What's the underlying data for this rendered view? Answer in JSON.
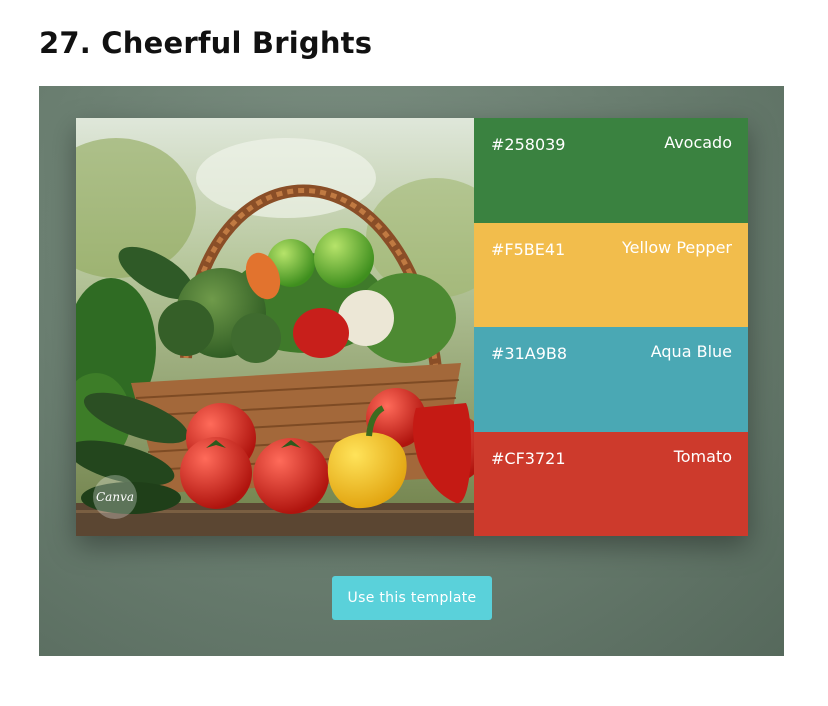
{
  "page": {
    "title": "27. Cheerful Brights"
  },
  "photo": {
    "icon": "vegetable-basket-photo",
    "brand": "Canva"
  },
  "palette": [
    {
      "hex": "#258039",
      "name": "Avocado",
      "color": "#3a8240"
    },
    {
      "hex": "#F5BE41",
      "name": "Yellow Pepper",
      "color": "#f2bd4c"
    },
    {
      "hex": "#31A9B8",
      "name": "Aqua Blue",
      "color": "#4aa8b4"
    },
    {
      "hex": "#CF3721",
      "name": "Tomato",
      "color": "#cd3a2c"
    }
  ],
  "cta": {
    "label": "Use this template",
    "color": "#5ad1da"
  },
  "colors": {
    "stage_background": "#6c8072"
  }
}
